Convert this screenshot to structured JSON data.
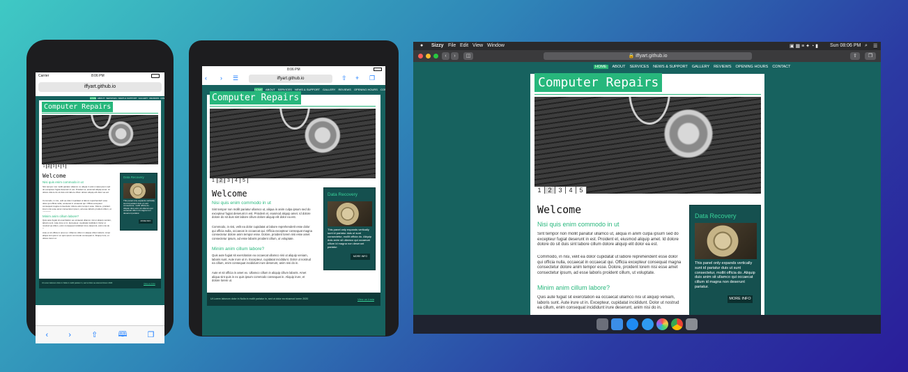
{
  "site": {
    "brand": "Computer Repairs",
    "nav": [
      "HOME",
      "ABOUT",
      "SERVICES",
      "NEWS & SUPPORT",
      "GALLERY",
      "REVIEWS",
      "OPENING HOURS",
      "CONTACT"
    ],
    "pager": [
      "1",
      "2",
      "3",
      "4",
      "5"
    ],
    "welcome": "Welcome",
    "subhead1": "Nisi quis enim commodo in ut",
    "para1": "Sint tempor non mollit pariatur ullamco ut, aliqua in anim culpa ipsum sed do excepteur fugiat deserunt in est. Proident et, eiusmod aliquip amet. Id dolore dolore do sit duis sint labore cillum dolore aliquip elit dolor ea est.",
    "para2": "Commodo, in nisi, velit ea dolor cupidatat ut labore reprehenderit esse dolor qui officia nulla, occaecat in occaecat qui. Officia excepteur consequat magna consectetur dolore anim tempor esse. Dolore, proident lorem nisi esse amet consectetur ipsum, ad esse laboris proident cillum, ut voluptate.",
    "subhead2": "Minim anim cillum labore?",
    "para3": "Quis aute fugiat sit exercitation ea occaecat ullamco nisi ut aliquip veniam, laboris sunt. Aute irure ut in. Excepteur, cupidatat incididunt. Dolor ut nostrud ea cillum, enim consequat incididunt irure deserunt, anim nisi do in.",
    "para4": "Aute et sit officia in amet ex. Ullamco cillum in aliquip cillum laboris. Amet aliqua sint quis in ex quis ipsum commodo consequat in. Aliquip irure, et dolore lorem ut.",
    "aside_title": "Data Recovery",
    "aside_text": "This panel only expands vertically sunt id pariatur duis ut sunt consectetur, mollit officia do. Aliquip duis anim sit ullamco qui occaecat cillum id magna non deserunt pariatur.",
    "aside_button": "MORE INFO",
    "footer_left": "Ut Lorem laborum dolor in Nulla in mollit pariatur in, sed ut dolor ea eiusmod lorem 2020",
    "footer_right": "View on Insta"
  },
  "phone": {
    "carrier": "Carrier",
    "time": "8:06 PM",
    "url": "iffyart.github.io",
    "icons": [
      "back-icon",
      "forward-icon",
      "share-icon",
      "bookmarks-icon",
      "tabs-icon"
    ]
  },
  "tablet": {
    "time": "8:06 PM",
    "url": "iffyart.github.io"
  },
  "desktop": {
    "app_name": "Sizzy",
    "menus": [
      "File",
      "Edit",
      "View",
      "Window"
    ],
    "clock": "Sun 08:06 PM",
    "url": "iffyart.github.io"
  },
  "colors": {
    "accent": "#27b77c",
    "site_bg": "#17625f",
    "aside_bg": "#15504f",
    "footer_bg": "#0e3a39"
  }
}
